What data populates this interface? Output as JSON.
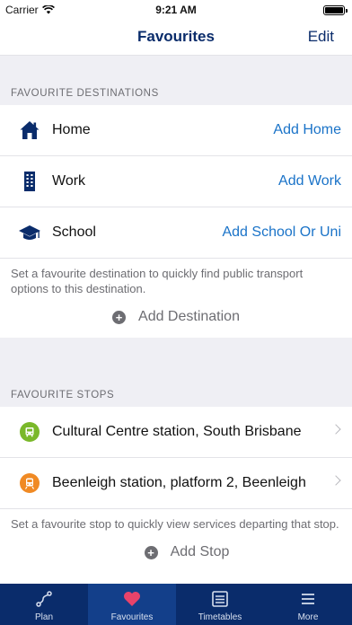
{
  "status": {
    "carrier": "Carrier",
    "time": "9:21 AM"
  },
  "nav": {
    "title": "Favourites",
    "edit_label": "Edit"
  },
  "destinations": {
    "header": "FAVOURITE DESTINATIONS",
    "items": [
      {
        "label": "Home",
        "action": "Add Home",
        "icon": "home-icon"
      },
      {
        "label": "Work",
        "action": "Add Work",
        "icon": "building-icon"
      },
      {
        "label": "School",
        "action": "Add School Or Uni",
        "icon": "graduation-cap-icon"
      }
    ],
    "hint": "Set a favourite destination to quickly find public transport options to this destination.",
    "add_label": "Add Destination"
  },
  "stops": {
    "header": "FAVOURITE STOPS",
    "items": [
      {
        "label": "Cultural Centre station, South Brisbane",
        "icon": "bus-icon",
        "color": "#7ab82a"
      },
      {
        "label": "Beenleigh station, platform 2, Beenleigh",
        "icon": "train-icon",
        "color": "#f08a24"
      }
    ],
    "hint": "Set a favourite stop to quickly view services departing that stop.",
    "add_label": "Add Stop"
  },
  "tabs": [
    {
      "label": "Plan",
      "icon": "route-icon"
    },
    {
      "label": "Favourites",
      "icon": "heart-icon",
      "active": true
    },
    {
      "label": "Timetables",
      "icon": "timetable-icon"
    },
    {
      "label": "More",
      "icon": "menu-icon"
    }
  ],
  "colors": {
    "brand_navy": "#0a2c6b",
    "link_blue": "#1a73c8",
    "heart": "#e8436a"
  }
}
